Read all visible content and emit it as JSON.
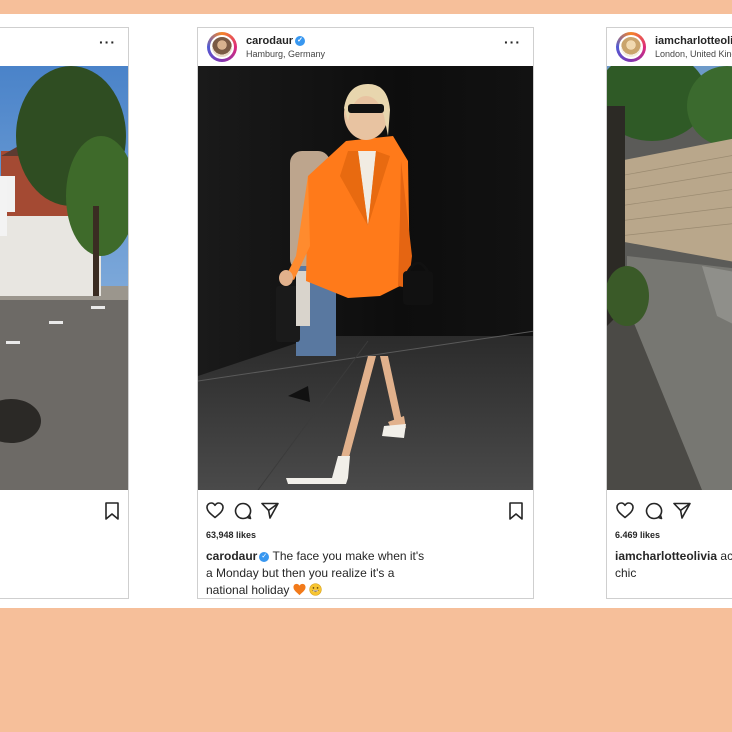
{
  "colors": {
    "peach": "#f6bf9a",
    "blazer": "#ff7a1a",
    "verified": "#3897f0"
  },
  "left_post": {
    "more_icon": "more-horizontal-icon",
    "bookmark_icon": "bookmark-icon"
  },
  "center_post": {
    "username": "carodaur",
    "location": "Hamburg, Germany",
    "likes": "63,948 likes",
    "caption_user": "carodaur",
    "caption_text": "The face you make when it's a Monday but then you realize it's a national holiday",
    "icons": [
      "heart-icon",
      "comment-icon",
      "share-icon",
      "bookmark-icon"
    ]
  },
  "right_post": {
    "username": "iamcharlotteolivia",
    "location": "London, United Kingdom",
    "likes": "6.469 likes",
    "caption_user": "iamcharlotteolivia",
    "caption_text": "ac... never looked so chic"
  }
}
